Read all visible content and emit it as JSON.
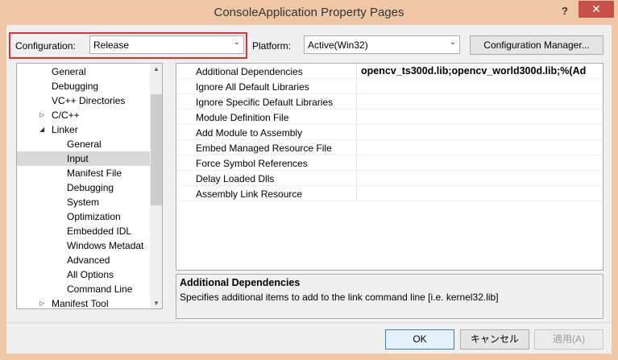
{
  "window": {
    "title": "ConsoleApplication Property Pages",
    "help_glyph": "?",
    "close_glyph": "✕"
  },
  "toolbar": {
    "configuration_label": "Configuration:",
    "configuration_value": "Release",
    "platform_label": "Platform:",
    "platform_value": "Active(Win32)",
    "config_manager_label": "Configuration Manager...",
    "dropdown_glyph": "⌄"
  },
  "tree": {
    "items": [
      {
        "label": "General",
        "twisty": ""
      },
      {
        "label": "Debugging",
        "twisty": ""
      },
      {
        "label": "VC++ Directories",
        "twisty": ""
      },
      {
        "label": "C/C++",
        "twisty": "▷"
      },
      {
        "label": "Linker",
        "twisty": "◢"
      },
      {
        "label": "General",
        "twisty": ""
      },
      {
        "label": "Input",
        "twisty": "",
        "selected": true
      },
      {
        "label": "Manifest File",
        "twisty": ""
      },
      {
        "label": "Debugging",
        "twisty": ""
      },
      {
        "label": "System",
        "twisty": ""
      },
      {
        "label": "Optimization",
        "twisty": ""
      },
      {
        "label": "Embedded IDL",
        "twisty": ""
      },
      {
        "label": "Windows Metadat",
        "twisty": ""
      },
      {
        "label": "Advanced",
        "twisty": ""
      },
      {
        "label": "All Options",
        "twisty": ""
      },
      {
        "label": "Command Line",
        "twisty": ""
      },
      {
        "label": "Manifest Tool",
        "twisty": "▷"
      }
    ],
    "scroll_up_glyph": "▲",
    "scroll_down_glyph": "▼"
  },
  "properties": {
    "rows": [
      {
        "name": "Additional Dependencies",
        "value": "opencv_ts300d.lib;opencv_world300d.lib;%(Ad"
      },
      {
        "name": "Ignore All Default Libraries",
        "value": ""
      },
      {
        "name": "Ignore Specific Default Libraries",
        "value": ""
      },
      {
        "name": "Module Definition File",
        "value": ""
      },
      {
        "name": "Add Module to Assembly",
        "value": ""
      },
      {
        "name": "Embed Managed Resource File",
        "value": ""
      },
      {
        "name": "Force Symbol References",
        "value": ""
      },
      {
        "name": "Delay Loaded Dlls",
        "value": ""
      },
      {
        "name": "Assembly Link Resource",
        "value": ""
      }
    ]
  },
  "description": {
    "title": "Additional Dependencies",
    "text": "Specifies additional items to add to the link command line [i.e. kernel32.lib]"
  },
  "buttons": {
    "ok": "OK",
    "cancel": "キャンセル",
    "apply": "適用(A)"
  },
  "colors": {
    "frame": "#f0c7a4",
    "close": "#c7504b",
    "highlight_border": "#e03030",
    "ok_border": "#3c7fb1"
  }
}
